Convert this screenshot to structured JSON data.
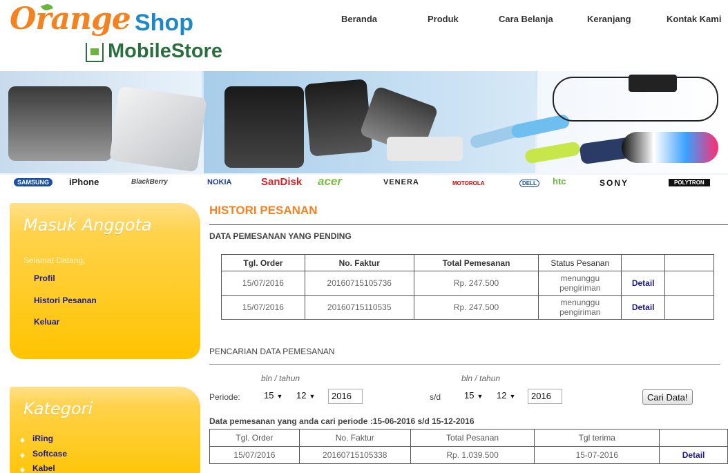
{
  "brand": {
    "name_part1": "Orange",
    "name_part2": "Shop",
    "subtitle": "MobileStore"
  },
  "nav": {
    "items": [
      "Beranda",
      "Produk",
      "Cara Belanja",
      "Keranjang",
      "Kontak Kami"
    ]
  },
  "banner": {
    "brand_logos": [
      "SAMSUNG",
      "iPhone",
      "BlackBerry",
      "NOKIA",
      "SanDisk",
      "acer",
      "VENERA",
      "MOTOROLA",
      "DELL",
      "htc",
      "SONY",
      "POLYTRON"
    ]
  },
  "sidebar": {
    "member_box": {
      "title": "Masuk Anggota",
      "greeting": "Selamat Datang,",
      "links": [
        "Profil",
        "Histori Pesanan",
        "Keluar"
      ]
    },
    "category_box": {
      "title": "Kategori",
      "items": [
        "iRing",
        "Softcase",
        "Kabel"
      ]
    }
  },
  "main": {
    "title": "HISTORI PESANAN",
    "pending_section_title": "DATA PEMESANAN YANG PENDING",
    "pending_table": {
      "headers": [
        "Tgl. Order",
        "No. Faktur",
        "Total Pemesanan",
        "Status Pesanan",
        "",
        ""
      ],
      "rows": [
        {
          "date": "15/07/2016",
          "invoice": "20160715105736",
          "total": "Rp. 247.500",
          "status_line1": "menunggu",
          "status_line2": "pengiriman",
          "action": "Detail"
        },
        {
          "date": "15/07/2016",
          "invoice": "20160715110535",
          "total": "Rp. 247.500",
          "status_line1": "menunggu",
          "status_line2": "pengiriman",
          "action": "Detail"
        }
      ]
    },
    "search_section_title": "PENCARIAN DATA PEMESANAN",
    "search": {
      "period_label": "Periode:",
      "hint_from": "bln / tahun",
      "hint_to": "bln / tahun",
      "separator": "s/d",
      "from_day": "15",
      "from_month": "12",
      "from_year": "2016",
      "to_day": "15",
      "to_month": "12",
      "to_year": "2016",
      "button": "Cari Data!"
    },
    "result_caption": "Data pemesanan yang anda cari periode :15-06-2016 s/d 15-12-2016",
    "result_table": {
      "headers": [
        "Tgl. Order",
        "No. Faktur",
        "Total Pesanan",
        "Tgl terima",
        ""
      ],
      "rows": [
        {
          "date": "15/07/2016",
          "invoice": "20160715105338",
          "total": "Rp. 1.039.500",
          "received": "15-07-2016",
          "action": "Detail"
        }
      ]
    }
  }
}
